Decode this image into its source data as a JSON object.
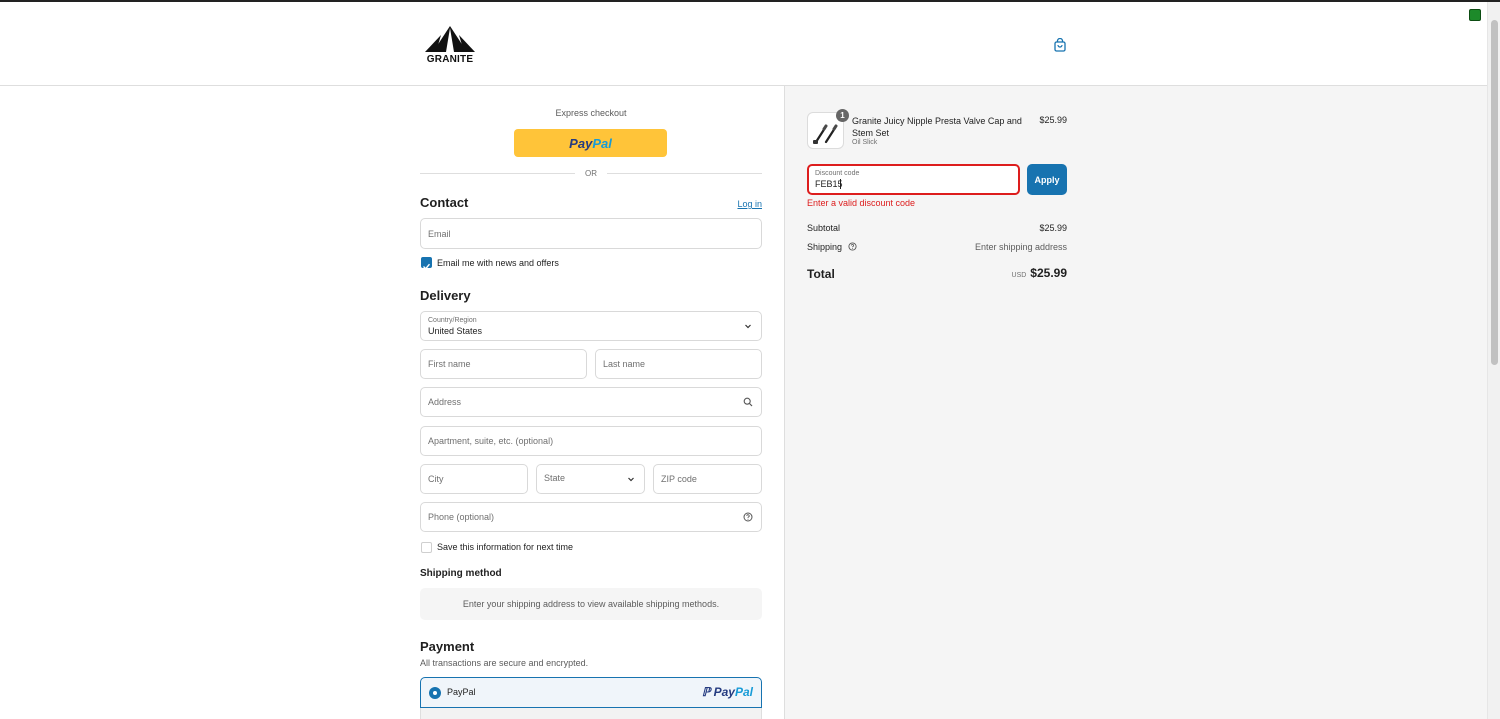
{
  "brand": {
    "logo_text": "GRANITE"
  },
  "express": {
    "label": "Express checkout",
    "paypal_a": "Pay",
    "paypal_b": "Pal",
    "or": "OR"
  },
  "contact": {
    "title": "Contact",
    "login": "Log in",
    "email_placeholder": "Email",
    "news_label": "Email me with news and offers",
    "news_checked": true
  },
  "delivery": {
    "title": "Delivery",
    "country_label": "Country/Region",
    "country_value": "United States",
    "first_name": "First name",
    "last_name": "Last name",
    "address": "Address",
    "apartment": "Apartment, suite, etc. (optional)",
    "city": "City",
    "state": "State",
    "zip": "ZIP code",
    "phone": "Phone (optional)",
    "save_label": "Save this information for next time",
    "save_checked": false
  },
  "shipping": {
    "title": "Shipping method",
    "message": "Enter your shipping address to view available shipping methods."
  },
  "payment": {
    "title": "Payment",
    "subtitle": "All transactions are secure and encrypted.",
    "method_label": "PayPal",
    "logo_a": "Pay",
    "logo_b": "Pal"
  },
  "summary": {
    "item": {
      "quantity": "1",
      "name": "Granite Juicy Nipple Presta Valve Cap and Stem Set",
      "variant": "Oil Slick",
      "price": "$25.99"
    },
    "discount": {
      "label": "Discount code",
      "value": "FEB15",
      "apply": "Apply",
      "error": "Enter a valid discount code"
    },
    "subtotal_label": "Subtotal",
    "subtotal_value": "$25.99",
    "shipping_label": "Shipping",
    "shipping_value": "Enter shipping address",
    "total_label": "Total",
    "currency": "USD",
    "total_value": "$25.99"
  },
  "colors": {
    "accent": "#1773b0",
    "paypal_yellow": "#ffc439",
    "error": "#dd1d1d"
  }
}
